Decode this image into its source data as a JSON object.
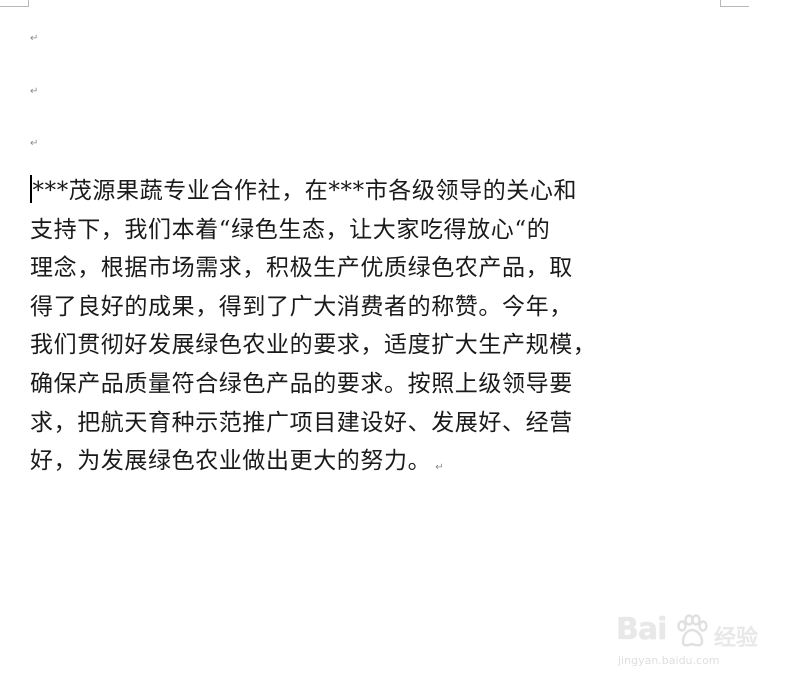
{
  "document": {
    "paragraph_mark": "↵",
    "lines": [
      "***茂源果蔬专业合作社，在***市各级领导的关心和",
      "支持下，我们本着“绿色生态，让大家吃得放心“的",
      "理念，根据市场需求，积极生产优质绿色农产品，取",
      "得了良好的成果，得到了广大消费者的称赞。今年，",
      "我们贯彻好发展绿色农业的要求，适度扩大生产规模，",
      "确保产品质量符合绿色产品的要求。按照上级领导要",
      "求，把航天育种示范推广项目建设好、发展好、经营",
      "好，为发展绿色农业做出更大的努力。"
    ]
  },
  "watermark": {
    "logo": "Bai",
    "logo_suffix": "经验",
    "url": "jingyan.baidu.com"
  },
  "icons": {
    "watermark_paw": "baidu-paw-icon"
  }
}
